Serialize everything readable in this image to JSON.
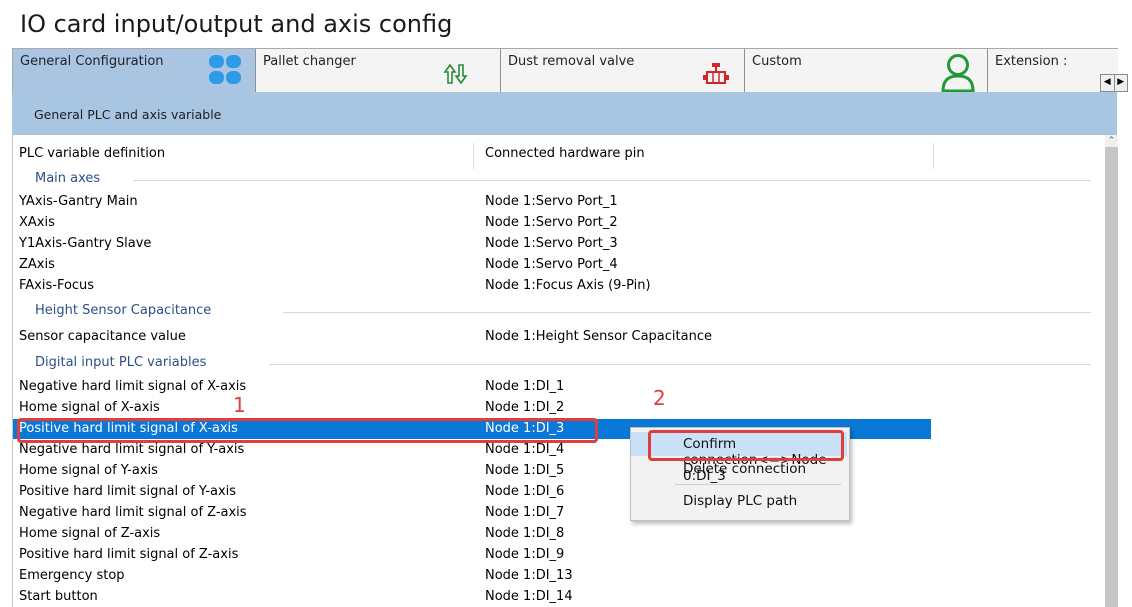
{
  "window": {
    "title": "IO card input/output and axis config"
  },
  "tabs": [
    {
      "label": "General Configuration",
      "icon": "four-petal-icon",
      "active": true
    },
    {
      "label": "Pallet changer",
      "icon": "pallet-icon"
    },
    {
      "label": "Dust removal valve",
      "icon": "valve-icon"
    },
    {
      "label": "Custom",
      "icon": "user-icon"
    },
    {
      "label": "Extension :"
    }
  ],
  "banner": {
    "label": "General PLC and axis variable"
  },
  "grid": {
    "headers": [
      "PLC variable definition",
      "Connected hardware pin"
    ],
    "groups": {
      "main_axes": "Main axes",
      "height_sensor": "Height Sensor Capacitance",
      "digital_input": "Digital input PLC variables"
    },
    "main_axes": [
      {
        "name": "YAxis-Gantry Main",
        "pin": "Node 1:Servo Port_1"
      },
      {
        "name": "XAxis",
        "pin": "Node 1:Servo Port_2"
      },
      {
        "name": "Y1Axis-Gantry Slave",
        "pin": "Node 1:Servo Port_3"
      },
      {
        "name": "ZAxis",
        "pin": "Node 1:Servo Port_4"
      },
      {
        "name": "FAxis-Focus",
        "pin": "Node 1:Focus Axis (9-Pin)"
      }
    ],
    "height_sensor": [
      {
        "name": "Sensor capacitance value",
        "pin": "Node 1:Height Sensor Capacitance"
      }
    ],
    "digital_input": [
      {
        "name": "Negative hard limit signal of X-axis",
        "pin": "Node 1:DI_1"
      },
      {
        "name": "Home signal of X-axis",
        "pin": "Node 1:DI_2"
      },
      {
        "name": "Positive hard limit signal of X-axis",
        "pin": "Node 1:DI_3",
        "selected": true
      },
      {
        "name": "Negative hard limit signal of Y-axis",
        "pin": "Node 1:DI_4"
      },
      {
        "name": "Home signal of Y-axis",
        "pin": "Node 1:DI_5"
      },
      {
        "name": "Positive hard limit signal of Y-axis",
        "pin": "Node 1:DI_6"
      },
      {
        "name": "Negative hard limit signal of Z-axis",
        "pin": "Node 1:DI_7"
      },
      {
        "name": "Home signal of Z-axis",
        "pin": "Node 1:DI_8"
      },
      {
        "name": "Positive hard limit signal of Z-axis",
        "pin": "Node 1:DI_9"
      },
      {
        "name": "Emergency stop",
        "pin": "Node 1:DI_13"
      },
      {
        "name": "Start button",
        "pin": "Node 1:DI_14"
      }
    ]
  },
  "annotations": {
    "one": "1",
    "two": "2",
    "color": "#e23d3d"
  },
  "context_menu": {
    "items": [
      "Confirm connection<=>Node 0:DI_3",
      "Delete connection",
      "Display PLC path"
    ]
  },
  "colors": {
    "selection": "#0a78d7",
    "banner": "#a8c6e2",
    "group_text": "#2a4f8a"
  }
}
